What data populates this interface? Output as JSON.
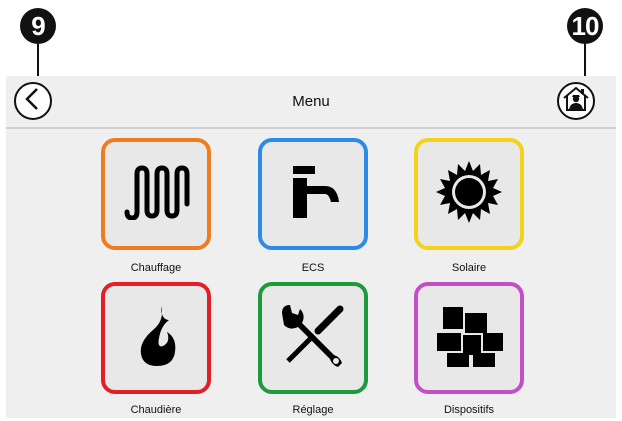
{
  "callouts": {
    "left": "9",
    "right": "10"
  },
  "header": {
    "title": "Menu"
  },
  "nav": {
    "back_icon": "chevron-left-icon",
    "home_icon": "house-person-icon"
  },
  "tiles": [
    {
      "label": "Chauffage",
      "color": "#ee7d22",
      "icon": "radiator-coil-icon"
    },
    {
      "label": "ECS",
      "color": "#2d8be6",
      "icon": "faucet-icon"
    },
    {
      "label": "Solaire",
      "color": "#f2d21a",
      "icon": "sun-icon"
    },
    {
      "label": "Chaudière",
      "color": "#e21f26",
      "icon": "flame-icon"
    },
    {
      "label": "Réglage",
      "color": "#1e9a3c",
      "icon": "wrench-screwdriver-icon"
    },
    {
      "label": "Dispositifs",
      "color": "#c24fc7",
      "icon": "devices-blocks-icon"
    }
  ]
}
